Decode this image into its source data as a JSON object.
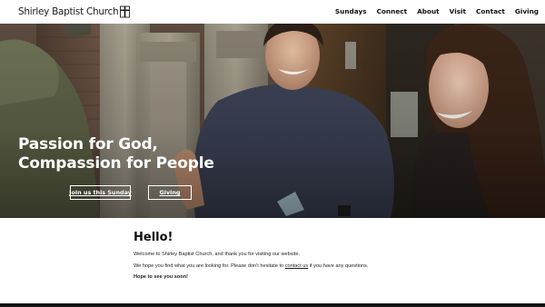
{
  "header": {
    "logo_text": "Shirley Baptist Church",
    "nav": [
      "Sundays",
      "Connect",
      "About",
      "Visit",
      "Contact",
      "Giving"
    ]
  },
  "hero": {
    "title_line1": "Passion for God,",
    "title_line2": "Compassion for People",
    "button_sunday": "Join us this Sunday",
    "button_giving": "Giving"
  },
  "content": {
    "heading": "Hello!",
    "para1": "Welcome to Shirley Baptist Church, and thank you for visiting our website.",
    "para2_before": "We hope you find what you are looking for. Please don't hesitate to",
    "para2_link": "contact us",
    "para2_after": "if you have any questions.",
    "closing": "Hope to see you soon!"
  },
  "colors": {
    "header_bg": "#ffffff",
    "text": "#111111",
    "hero_text": "#ffffff",
    "footer": "#111111"
  },
  "icons": [
    "cross-logo-icon"
  ]
}
